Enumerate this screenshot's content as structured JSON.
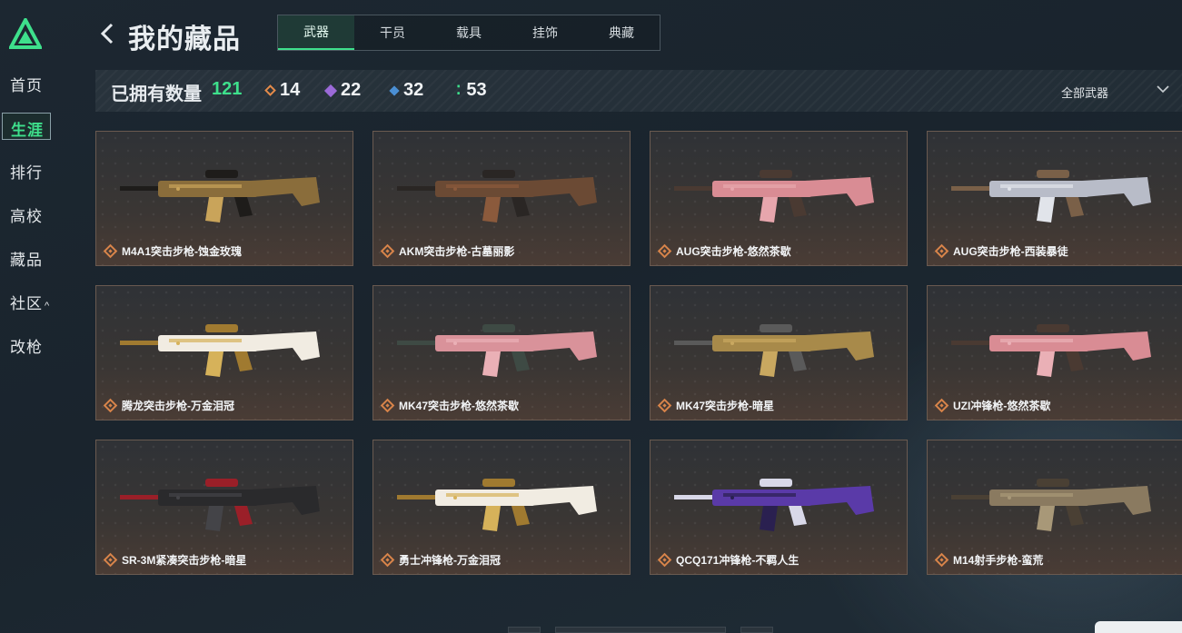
{
  "sidebar": {
    "items": [
      {
        "label": "首页"
      },
      {
        "label": "生涯"
      },
      {
        "label": "排行"
      },
      {
        "label": "高校"
      },
      {
        "label": "藏品"
      },
      {
        "label": "社区"
      },
      {
        "label": "改枪"
      }
    ],
    "active_index": 1
  },
  "header": {
    "title": "我的藏品",
    "tabs": [
      {
        "label": "武器"
      },
      {
        "label": "干员"
      },
      {
        "label": "载具"
      },
      {
        "label": "挂饰"
      },
      {
        "label": "典藏"
      }
    ],
    "active_tab": 0
  },
  "stats": {
    "owned_label": "已拥有数量",
    "owned_count": "121",
    "rarities": [
      {
        "count": "14",
        "color": "#e38a4a"
      },
      {
        "count": "22",
        "color": "#9b6ad8"
      },
      {
        "count": "32",
        "color": "#4a8fd4"
      },
      {
        "count": "53",
        "color": "#3ee08c"
      }
    ],
    "filter_label": "全部武器"
  },
  "cards": [
    {
      "name": "M4A1突击步枪-蚀金玫瑰",
      "colors": [
        "#8a6d3b",
        "#1e1c1a",
        "#c9a45a"
      ]
    },
    {
      "name": "AKM突击步枪-古墓丽影",
      "colors": [
        "#6b4a34",
        "#2a2624",
        "#8b5a3c"
      ]
    },
    {
      "name": "AUG突击步枪-悠然茶歇",
      "colors": [
        "#d98c94",
        "#4a3a32",
        "#e7a6ad"
      ]
    },
    {
      "name": "AUG突击步枪-西装暴徒",
      "colors": [
        "#b8bcc8",
        "#7a6048",
        "#e1e4ea"
      ]
    },
    {
      "name": "腾龙突击步枪-万金泪冠",
      "colors": [
        "#f1ece2",
        "#a07a30",
        "#d6b25a"
      ]
    },
    {
      "name": "MK47突击步枪-悠然茶歇",
      "colors": [
        "#d9929a",
        "#3e4a44",
        "#eab0b6"
      ]
    },
    {
      "name": "MK47突击步枪-暗星",
      "colors": [
        "#a88a4a",
        "#5a5a5a",
        "#c9a860"
      ]
    },
    {
      "name": "UZI冲锋枪-悠然茶歇",
      "colors": [
        "#d98c94",
        "#4a3a32",
        "#eab0b6"
      ]
    },
    {
      "name": "SR-3M紧凑突击步枪-暗星",
      "colors": [
        "#2a2a2c",
        "#9a1f28",
        "#444448"
      ]
    },
    {
      "name": "勇士冲锋枪-万金泪冠",
      "colors": [
        "#f1ece2",
        "#a07a30",
        "#d6b25a"
      ]
    },
    {
      "name": "QCQ171冲锋枪-不羁人生",
      "colors": [
        "#5a3aa8",
        "#d8d8e8",
        "#2a2050"
      ]
    },
    {
      "name": "M14射手步枪-蛮荒",
      "colors": [
        "#8a7a60",
        "#4a4034",
        "#a89878"
      ]
    }
  ]
}
